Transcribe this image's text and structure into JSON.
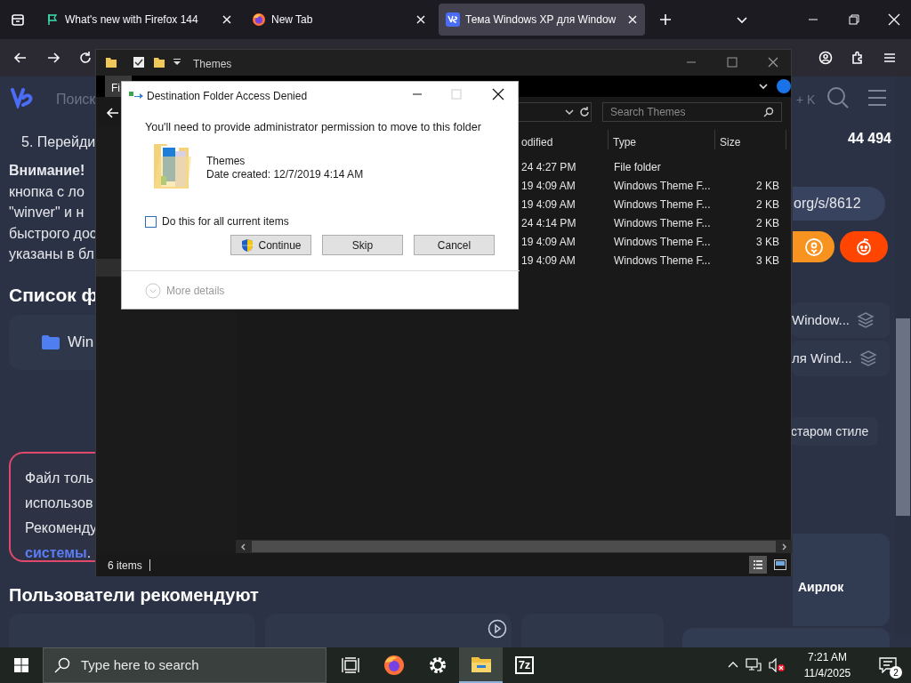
{
  "browser": {
    "tabs": [
      {
        "label": "What's new with Firefox 144",
        "selected": false
      },
      {
        "label": "New Tab",
        "selected": false
      },
      {
        "label": "Тема Windows XP для Window",
        "selected": true
      }
    ]
  },
  "page": {
    "search_placeholder": "Поиск",
    "shortcut_hint": "+ K",
    "step": "5. Перейди",
    "warning_lead": "Внимание!",
    "warning_lines": [
      "кнопка с ло",
      "\"winver\" и н",
      "быстрого дос",
      "указаны в бл"
    ],
    "files_heading": "Список ф",
    "file_card": "Win",
    "notice_lines": [
      "Файл толь",
      "использов",
      "Рекоменду"
    ],
    "notice_link": "системы",
    "notice_end": ".",
    "recommend_heading": "Пользователи рекомендуют",
    "count": "44 494",
    "link": "org/s/8612",
    "related": [
      "Window...",
      "ля Wind..."
    ],
    "tag": "старом стиле",
    "card_title": "Аирлок"
  },
  "explorer": {
    "title": "Themes",
    "ribbon_tab": "Fi",
    "search_placeholder": "Search Themes",
    "columns": [
      "odified",
      "Type",
      "Size"
    ],
    "rows": [
      {
        "modified": "24 4:27 PM",
        "type": "File folder"
      },
      {
        "modified": "19 4:09 AM",
        "type": "Windows Theme F...",
        "size": "2 KB"
      },
      {
        "modified": "19 4:09 AM",
        "type": "Windows Theme F...",
        "size": "2 KB"
      },
      {
        "modified": "24 4:14 PM",
        "type": "Windows Theme F...",
        "size": "2 KB"
      },
      {
        "modified": "19 4:09 AM",
        "type": "Windows Theme F...",
        "size": "3 KB"
      },
      {
        "modified": "19 4:09 AM",
        "type": "Windows Theme F...",
        "size": "3 KB"
      }
    ],
    "status": "6 items"
  },
  "dialog": {
    "title": "Destination Folder Access Denied",
    "message": "You'll need to provide administrator permission to move to this folder",
    "item_name": "Themes",
    "item_date": "Date created: 12/7/2019 4:14 AM",
    "checkbox": {
      "label": "Do this for all current items",
      "checked": false
    },
    "buttons": [
      {
        "label": "Continue",
        "kind": "shield"
      },
      {
        "label": "Skip",
        "kind": "plain"
      },
      {
        "label": "Cancel",
        "kind": "plain"
      }
    ],
    "more_details": "More details"
  },
  "taskbar": {
    "search_placeholder": "Type here to search",
    "apps": [
      {
        "kind": "taskview",
        "selected": false
      },
      {
        "kind": "firefox",
        "selected": false
      },
      {
        "kind": "settings",
        "selected": false
      },
      {
        "kind": "explorer",
        "selected": true
      },
      {
        "kind": "archiver",
        "label": "7z",
        "selected": false
      }
    ],
    "time": "7:21 AM",
    "date": "11/4/2025",
    "notifications": "2"
  }
}
